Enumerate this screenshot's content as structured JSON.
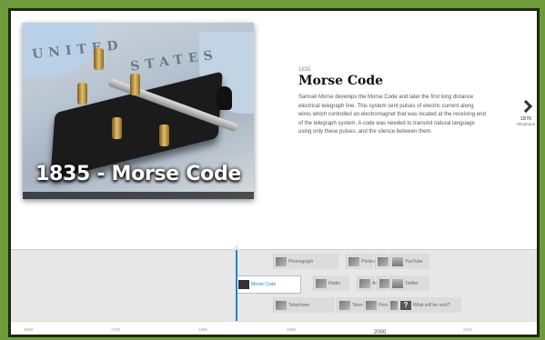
{
  "slide": {
    "photo_caption": "1835 - Morse Code",
    "map_words": [
      "UNITED",
      "STATES",
      "S T A T E S"
    ],
    "year": "1835",
    "title": "Morse Code",
    "description": "Samuel Morse develops the Morse Code and later the first long distance electrical telegraph line. This system sent pulses of electric current along wires which controlled an electromagnet that was located at the receiving end of the telegraph system. A code was needed to transmit natural language using only these pulses, and the silence between them."
  },
  "next": {
    "year": "1876",
    "label": "Telephone"
  },
  "timeline": {
    "events": [
      {
        "label": "Phonograph"
      },
      {
        "label": "Photos"
      },
      {
        "label": "YouTube"
      },
      {
        "label": "Morse Code"
      },
      {
        "label": "Radio"
      },
      {
        "label": "Ani"
      },
      {
        "label": "Twitter"
      },
      {
        "label": "Telephone"
      },
      {
        "label": "Telev"
      },
      {
        "label": "Pers"
      },
      {
        "label": "What will be next?"
      }
    ],
    "ruler": [
      "1600",
      "1700",
      "1800",
      "1900",
      "2000",
      "2100"
    ]
  }
}
